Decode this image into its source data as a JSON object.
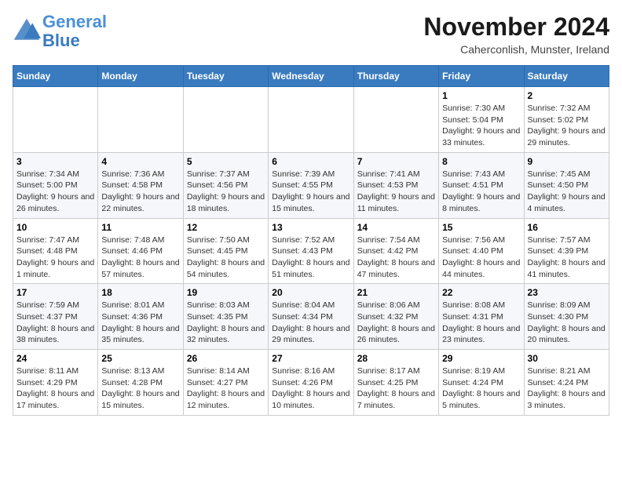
{
  "logo": {
    "line1": "General",
    "line2": "Blue"
  },
  "title": "November 2024",
  "subtitle": "Caherconlish, Munster, Ireland",
  "days_of_week": [
    "Sunday",
    "Monday",
    "Tuesday",
    "Wednesday",
    "Thursday",
    "Friday",
    "Saturday"
  ],
  "weeks": [
    [
      {
        "day": "",
        "info": ""
      },
      {
        "day": "",
        "info": ""
      },
      {
        "day": "",
        "info": ""
      },
      {
        "day": "",
        "info": ""
      },
      {
        "day": "",
        "info": ""
      },
      {
        "day": "1",
        "info": "Sunrise: 7:30 AM\nSunset: 5:04 PM\nDaylight: 9 hours and 33 minutes."
      },
      {
        "day": "2",
        "info": "Sunrise: 7:32 AM\nSunset: 5:02 PM\nDaylight: 9 hours and 29 minutes."
      }
    ],
    [
      {
        "day": "3",
        "info": "Sunrise: 7:34 AM\nSunset: 5:00 PM\nDaylight: 9 hours and 26 minutes."
      },
      {
        "day": "4",
        "info": "Sunrise: 7:36 AM\nSunset: 4:58 PM\nDaylight: 9 hours and 22 minutes."
      },
      {
        "day": "5",
        "info": "Sunrise: 7:37 AM\nSunset: 4:56 PM\nDaylight: 9 hours and 18 minutes."
      },
      {
        "day": "6",
        "info": "Sunrise: 7:39 AM\nSunset: 4:55 PM\nDaylight: 9 hours and 15 minutes."
      },
      {
        "day": "7",
        "info": "Sunrise: 7:41 AM\nSunset: 4:53 PM\nDaylight: 9 hours and 11 minutes."
      },
      {
        "day": "8",
        "info": "Sunrise: 7:43 AM\nSunset: 4:51 PM\nDaylight: 9 hours and 8 minutes."
      },
      {
        "day": "9",
        "info": "Sunrise: 7:45 AM\nSunset: 4:50 PM\nDaylight: 9 hours and 4 minutes."
      }
    ],
    [
      {
        "day": "10",
        "info": "Sunrise: 7:47 AM\nSunset: 4:48 PM\nDaylight: 9 hours and 1 minute."
      },
      {
        "day": "11",
        "info": "Sunrise: 7:48 AM\nSunset: 4:46 PM\nDaylight: 8 hours and 57 minutes."
      },
      {
        "day": "12",
        "info": "Sunrise: 7:50 AM\nSunset: 4:45 PM\nDaylight: 8 hours and 54 minutes."
      },
      {
        "day": "13",
        "info": "Sunrise: 7:52 AM\nSunset: 4:43 PM\nDaylight: 8 hours and 51 minutes."
      },
      {
        "day": "14",
        "info": "Sunrise: 7:54 AM\nSunset: 4:42 PM\nDaylight: 8 hours and 47 minutes."
      },
      {
        "day": "15",
        "info": "Sunrise: 7:56 AM\nSunset: 4:40 PM\nDaylight: 8 hours and 44 minutes."
      },
      {
        "day": "16",
        "info": "Sunrise: 7:57 AM\nSunset: 4:39 PM\nDaylight: 8 hours and 41 minutes."
      }
    ],
    [
      {
        "day": "17",
        "info": "Sunrise: 7:59 AM\nSunset: 4:37 PM\nDaylight: 8 hours and 38 minutes."
      },
      {
        "day": "18",
        "info": "Sunrise: 8:01 AM\nSunset: 4:36 PM\nDaylight: 8 hours and 35 minutes."
      },
      {
        "day": "19",
        "info": "Sunrise: 8:03 AM\nSunset: 4:35 PM\nDaylight: 8 hours and 32 minutes."
      },
      {
        "day": "20",
        "info": "Sunrise: 8:04 AM\nSunset: 4:34 PM\nDaylight: 8 hours and 29 minutes."
      },
      {
        "day": "21",
        "info": "Sunrise: 8:06 AM\nSunset: 4:32 PM\nDaylight: 8 hours and 26 minutes."
      },
      {
        "day": "22",
        "info": "Sunrise: 8:08 AM\nSunset: 4:31 PM\nDaylight: 8 hours and 23 minutes."
      },
      {
        "day": "23",
        "info": "Sunrise: 8:09 AM\nSunset: 4:30 PM\nDaylight: 8 hours and 20 minutes."
      }
    ],
    [
      {
        "day": "24",
        "info": "Sunrise: 8:11 AM\nSunset: 4:29 PM\nDaylight: 8 hours and 17 minutes."
      },
      {
        "day": "25",
        "info": "Sunrise: 8:13 AM\nSunset: 4:28 PM\nDaylight: 8 hours and 15 minutes."
      },
      {
        "day": "26",
        "info": "Sunrise: 8:14 AM\nSunset: 4:27 PM\nDaylight: 8 hours and 12 minutes."
      },
      {
        "day": "27",
        "info": "Sunrise: 8:16 AM\nSunset: 4:26 PM\nDaylight: 8 hours and 10 minutes."
      },
      {
        "day": "28",
        "info": "Sunrise: 8:17 AM\nSunset: 4:25 PM\nDaylight: 8 hours and 7 minutes."
      },
      {
        "day": "29",
        "info": "Sunrise: 8:19 AM\nSunset: 4:24 PM\nDaylight: 8 hours and 5 minutes."
      },
      {
        "day": "30",
        "info": "Sunrise: 8:21 AM\nSunset: 4:24 PM\nDaylight: 8 hours and 3 minutes."
      }
    ]
  ]
}
